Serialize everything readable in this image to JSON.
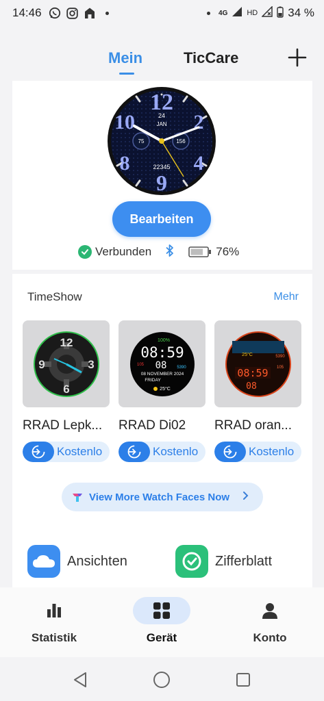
{
  "status_bar": {
    "time": "14:46",
    "network": "4G",
    "hd": "HD",
    "battery": "34 %"
  },
  "header": {
    "tabs": [
      {
        "label": "Mein",
        "active": true
      },
      {
        "label": "TicCare",
        "active": false
      }
    ],
    "add_icon": "plus-icon"
  },
  "device": {
    "watch_face": {
      "day": "24",
      "month": "JAN",
      "left_value": "75",
      "right_value": "156",
      "steps": "22345",
      "numerals": [
        "12",
        "10",
        "2",
        "8",
        "4",
        "9"
      ]
    },
    "edit_label": "Bearbeiten",
    "status_label": "Verbunden",
    "battery_percent": "76%",
    "battery_level": 0.76
  },
  "timeshow": {
    "title": "TimeShow",
    "more_label": "Mehr",
    "faces": [
      {
        "name": "RRAD Lepk...",
        "price_label": "Kostenlo",
        "numerals": [
          "12",
          "3",
          "6",
          "9"
        ]
      },
      {
        "name": "RRAD  Di02",
        "price_label": "Kostenlo",
        "battery": "100%",
        "time": "08:59",
        "seconds": "08",
        "steps": "5390",
        "heart": "105",
        "date": "08 NOVEMBER 2024",
        "weekday": "FRIDAY",
        "temp": "25°C"
      },
      {
        "name": "RRAD oran...",
        "price_label": "Kostenlo",
        "temp": "25°C",
        "steps": "5390",
        "heart": "105",
        "time": "08:59",
        "seconds": "08"
      }
    ],
    "view_more_label": "View More Watch Faces Now"
  },
  "quick_actions": [
    {
      "label": "Ansichten",
      "icon": "cloud-icon",
      "color": "#3d8ef0"
    },
    {
      "label": "Zifferblatt",
      "icon": "clock-icon",
      "color": "#2bc07a"
    }
  ],
  "bottom_nav": [
    {
      "label": "Statistik",
      "icon": "bar-chart-icon",
      "active": false
    },
    {
      "label": "Gerät",
      "icon": "grid-icon",
      "active": true
    },
    {
      "label": "Konto",
      "icon": "person-icon",
      "active": false
    }
  ],
  "system_nav": [
    "back-icon",
    "home-icon",
    "recents-icon"
  ]
}
